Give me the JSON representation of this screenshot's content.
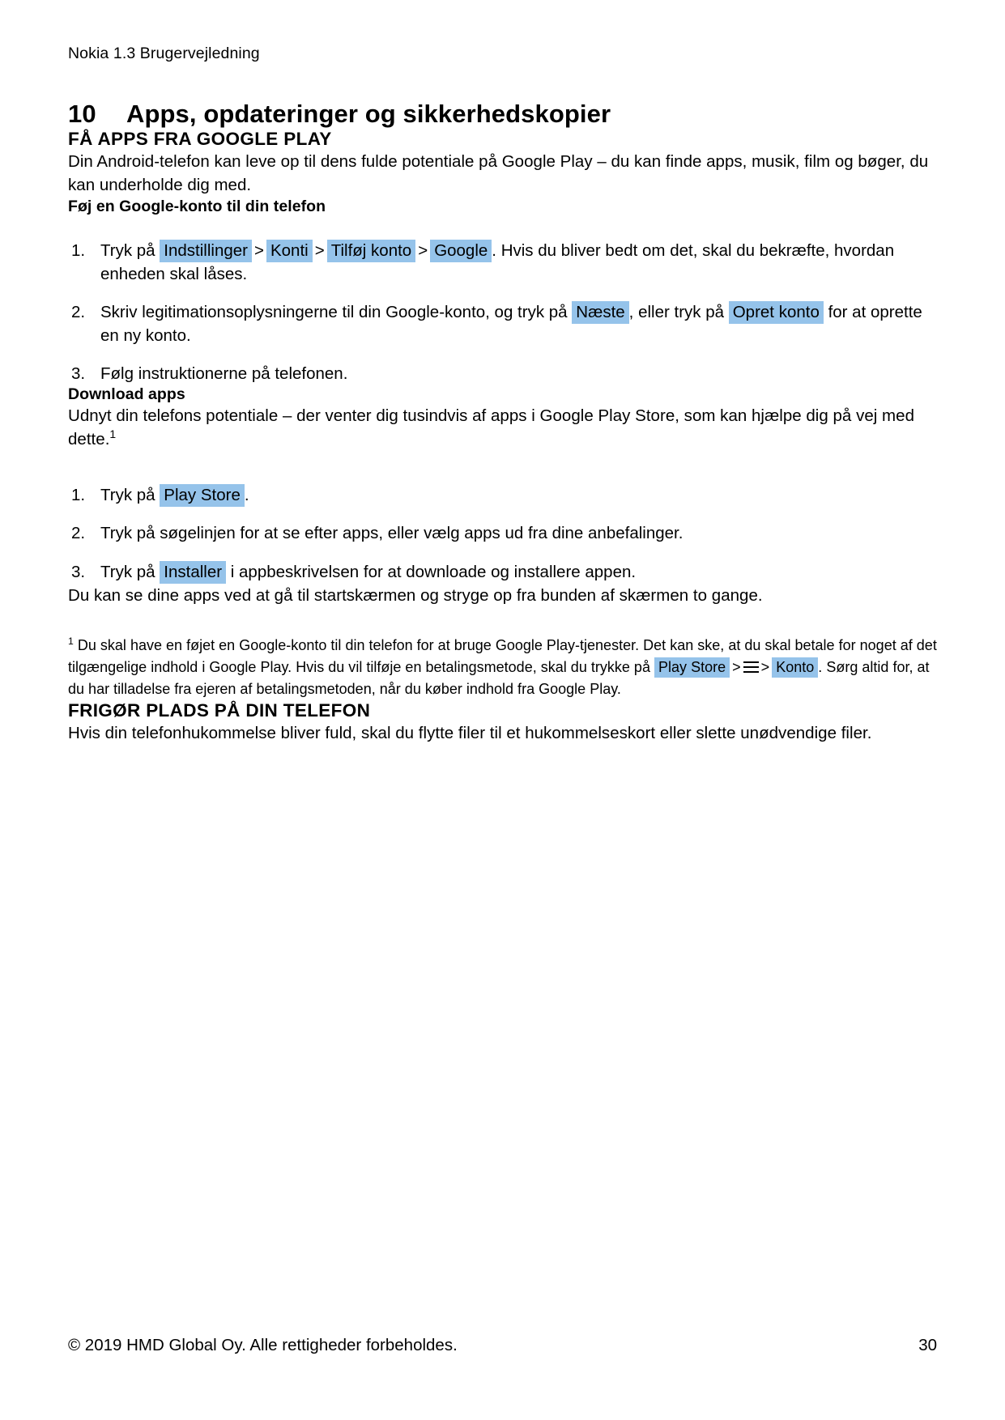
{
  "document": {
    "running_header": "Nokia 1.3 Brugervejledning"
  },
  "chapter": {
    "number": "10",
    "title": "Apps, opdateringer og sikkerhedskopier"
  },
  "sections": {
    "get_apps": {
      "heading": "FÅ APPS FRA GOOGLE PLAY",
      "intro": "Din Android-telefon kan leve op til dens fulde potentiale på Google Play – du kan finde apps, musik, film og bøger, du kan underholde dig med.",
      "add_account": {
        "heading": "Føj en Google-konto til din telefon",
        "step1": {
          "lead": "Tryk på",
          "ui_1": "Indstillinger",
          "sep_1": ">",
          "ui_2": "Konti",
          "sep_2": ">",
          "ui_3": "Tilføj konto",
          "sep_3": ">",
          "ui_4": "Google",
          "tail": ". Hvis du bliver bedt om det, skal du bekræfte, hvordan enheden skal låses."
        },
        "step2": {
          "lead": "Skriv legitimationsoplysningerne til din Google-konto, og tryk på",
          "ui_1": "Næste",
          "mid": ", eller tryk på",
          "ui_2": "Opret konto",
          "tail": "for at oprette en ny konto."
        },
        "step3": {
          "text": "Følg instruktionerne på telefonen."
        }
      },
      "download_apps": {
        "heading": "Download apps",
        "intro_before": "Udnyt din telefons potentiale – der venter dig tusindvis af apps i Google Play Store, som kan hjælpe dig på vej med dette.",
        "intro_footnote_marker": "1",
        "step1": {
          "lead": "Tryk på",
          "ui_1": "Play Store",
          "tail": "."
        },
        "step2": {
          "text": "Tryk på søgelinjen for at se efter apps, eller vælg apps ud fra dine anbefalinger."
        },
        "step3": {
          "lead": "Tryk på",
          "ui_1": "Installer",
          "tail": "i appbeskrivelsen for at downloade og installere appen."
        },
        "outro": "Du kan se dine apps ved at gå til startskærmen og stryge op fra bunden af skærmen to gange."
      },
      "footnote": {
        "marker": "1",
        "part_1": "Du skal have en føjet en Google-konto til din telefon for at bruge Google Play-tjenester. Det kan ske, at du skal betale for noget af det tilgængelige indhold i Google Play. Hvis du vil tilføje en betalingsmetode, skal du trykke på",
        "ui_1": "Play Store",
        "sep_1": ">",
        "icon_1": "hamburger-menu-icon",
        "sep_2": ">",
        "ui_2": "Konto",
        "part_2": ". Sørg altid for, at du har tilladelse fra ejeren af betalingsmetoden, når du køber indhold fra Google Play."
      }
    },
    "free_space": {
      "heading": "FRIGØR PLADS PÅ DIN TELEFON",
      "intro": "Hvis din telefonhukommelse bliver fuld, skal du flytte filer til et hukommelseskort eller slette unødvendige filer."
    }
  },
  "footer": {
    "copyright": "© 2019 HMD Global Oy. Alle rettigheder forbeholdes.",
    "page_number": "30"
  },
  "colors": {
    "ui_highlight": "#95c3ea",
    "text": "#000000",
    "background": "#ffffff"
  }
}
